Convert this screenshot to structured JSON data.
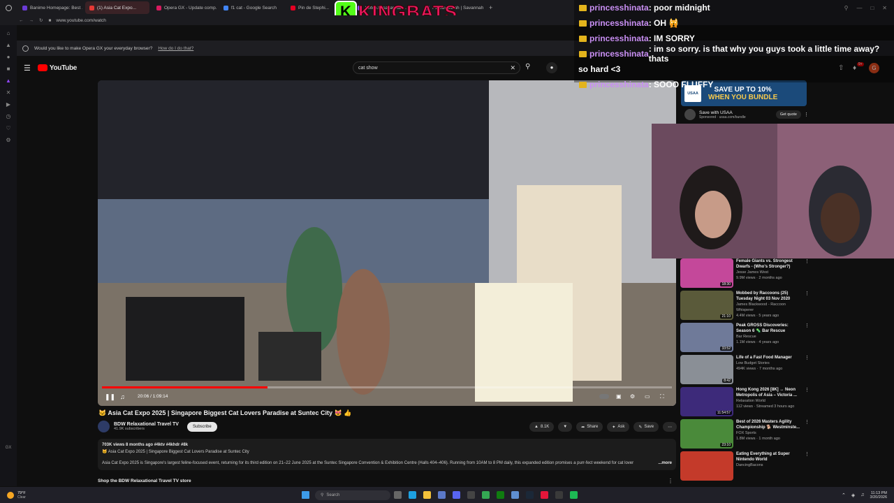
{
  "tabs": [
    {
      "label": "Banime Homepage: Best ...",
      "color": "#6a3bd6"
    },
    {
      "label": "(1) Asia Cat Expo...",
      "color": "#e53935"
    },
    {
      "label": "Opera GX - Update comp...",
      "color": "#d81b60"
    },
    {
      "label": "f1 cat - Google Search",
      "color": "#4285f4"
    },
    {
      "label": "Pin de Stephi...",
      "color": "#e60023"
    },
    {
      "label": "twitch.tv savannah...",
      "color": "#9146ff"
    },
    {
      "label": "F1 Savannah | Savannah ...",
      "color": "#6a3bd6"
    }
  ],
  "overlay_logo": "KINGBATS",
  "address": "www.youtube.com/watch",
  "opera_prompt": {
    "text": "Would you like to make Opera GX your everyday browser?",
    "link": "How do I do that?"
  },
  "youtube": {
    "logo": "YouTube",
    "search_value": "cat show",
    "avatar_letter": "G",
    "notif_count": "9+"
  },
  "video": {
    "time": "20:06 / 1:09:14",
    "title": "🐱 Asia Cat Expo 2025 | Singapore Biggest Cat Lovers Paradise at Suntec City 😻 👍",
    "progress_pct": 29
  },
  "channel": {
    "name": "BDW Relaxational Travel TV",
    "subs": "41.9K subscribers",
    "subscribe": "Subscribe"
  },
  "actions": {
    "likes": "8.1K",
    "share": "Share",
    "ask": "Ask",
    "save": "Save"
  },
  "description": {
    "meta": "703K views  8 months ago  #4ktv #4khdr #8k",
    "line1": "🐱 Asia Cat Expo 2025 | Singapore Biggest Cat Lovers Paradise at Suntec City",
    "line2": "Asia Cat Expo 2025 is Singapore's largest feline-focused event, returning for its third edition on 21–22 June 2025 at the Suntec Singapore Convention & Exhibition Centre (Halls 404–406). Running from 10AM to 8 PM daily, this expanded edition promises a purr-fect weekend for cat lover",
    "more": "...more",
    "shop": "Shop the BDW Relaxational Travel TV store"
  },
  "ad": {
    "headline1": "SAVE UP TO 10%",
    "headline2": "WHEN YOU BUNDLE",
    "brand": "USAA",
    "name": "Save with USAA",
    "sponsored": "Sponsored · usaa.com/bundle",
    "cta": "Get quote"
  },
  "chat": [
    {
      "user": "princesshinata",
      "msg": ": poor midnight"
    },
    {
      "user": "princesshinata",
      "msg": ": OH 🙀"
    },
    {
      "user": "princesshinata",
      "msg": ": IM SORRY"
    },
    {
      "user": "princesshinata",
      "msg": ": im so sorry. is that why you guys took a little time away? thats"
    },
    {
      "user": "",
      "msg": "so hard <3"
    },
    {
      "user": "princesshinata",
      "msg": ": SOOO FLUFFY"
    }
  ],
  "recs": [
    {
      "title": "Female Giants vs. Strongest Dwarfs - (Who's Stronger?)",
      "channel": "Jesse James West",
      "meta": "9.9M views · 2 months ago",
      "dur": "18:30",
      "color": "#c4489a"
    },
    {
      "title": "Mobbed by Raccoons  (25) Tuesday Night 03 Nov 2020",
      "channel": "James Blackwood - Raccoon Whisperer",
      "meta": "4.4M views · 5 years ago",
      "dur": "21:10",
      "color": "#5a5a3a"
    },
    {
      "title": "Peak GROSS Discoveries: Season 6 🦠 Bar Rescue",
      "channel": "Bar Rescue",
      "meta": "1.1M views · 4 years ago",
      "dur": "33:52",
      "color": "#6f7a99"
    },
    {
      "title": "Life of a Fast Food Manager",
      "channel": "Low Budget Stories",
      "meta": "494K views · 7 months ago",
      "dur": "8:42",
      "color": "#8a8f96"
    },
    {
      "title": "Hong Kong 2026 [8K] ↔ Neon Metropolis of Asia – Victoria ...",
      "channel": "Relaxation World",
      "meta": "112 views · Streamed 3 hours ago",
      "dur": "11:54:57",
      "color": "#3d2a7a"
    },
    {
      "title": "Best of 2026 Masters Agility Championship 🐕 Westminste...",
      "channel": "FOX Sports",
      "meta": "1.8M views · 1 month ago",
      "dur": "23:10",
      "color": "#4a8a3a"
    },
    {
      "title": "Eating Everything at Super Nintendo World",
      "channel": "DancingBacons",
      "meta": "",
      "dur": "",
      "color": "#c43a2a"
    }
  ],
  "taskbar": {
    "weather_temp": "79°F",
    "weather_text": "Clear",
    "search": "Search",
    "time": "11:13 PM",
    "date": "3/20/2026"
  }
}
